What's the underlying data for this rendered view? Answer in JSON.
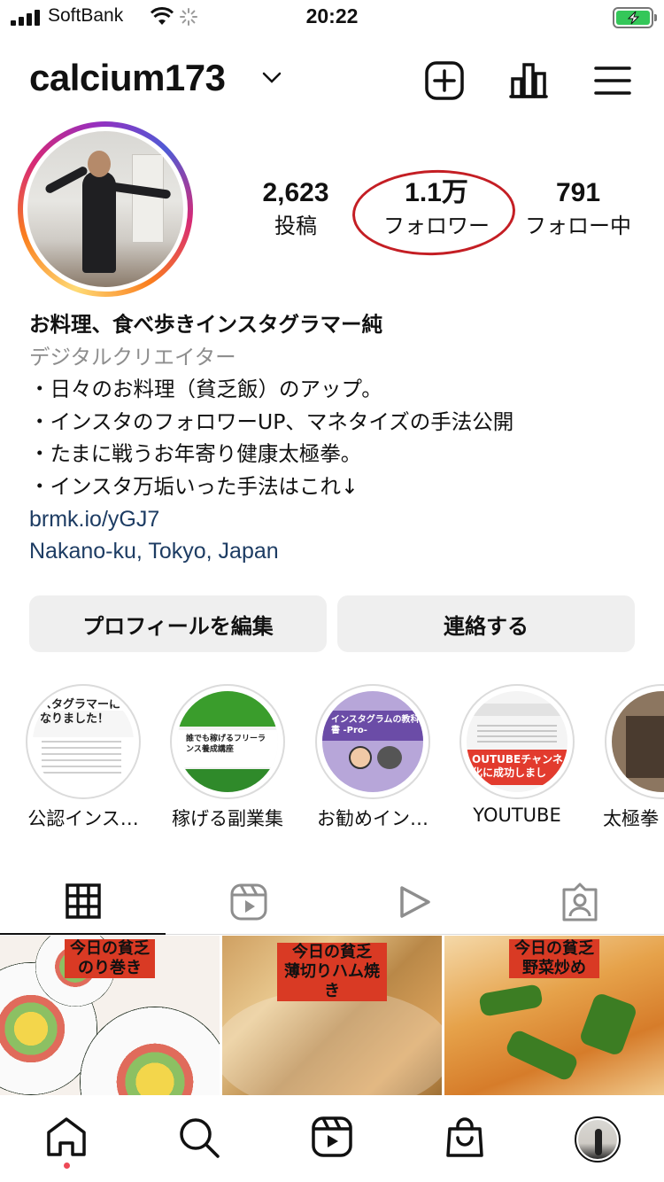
{
  "status_bar": {
    "carrier": "SoftBank",
    "time": "20:22"
  },
  "header": {
    "username": "calcium173",
    "icons": [
      "chevron-down-icon",
      "new-post-icon",
      "insights-icon",
      "menu-icon"
    ]
  },
  "stats": {
    "posts": {
      "value": "2,623",
      "label": "投稿"
    },
    "followers": {
      "value": "1.1万",
      "label": "フォロワー"
    },
    "following": {
      "value": "791",
      "label": "フォロー中"
    }
  },
  "annotation": {
    "color": "#c41e24"
  },
  "bio": {
    "name": "お料理、食べ歩きインスタグラマー純",
    "category": "デジタルクリエイター",
    "lines": [
      "・日々のお料理（貧乏飯）のアップ。",
      "・インスタのフォロワーUP、マネタイズの手法公開",
      "・たまに戦うお年寄り健康太極拳。",
      "・インスタ万垢いった手法はこれ↓"
    ],
    "link": "brmk.io/yGJ7",
    "location": "Nakano-ku, Tokyo, Japan"
  },
  "buttons": {
    "edit_profile": "プロフィールを編集",
    "contact": "連絡する"
  },
  "highlights": [
    {
      "label": "公認インス…",
      "thumb_text": "スタグラマーになりました！"
    },
    {
      "label": "稼げる副業集",
      "thumb_text": "誰でも稼げるフリーランス養成講座"
    },
    {
      "label": "お勧めイン…",
      "thumb_text": "インスタグラムの教科書 -Pro-"
    },
    {
      "label": "YOUTUBE",
      "thumb_text": "OUTUBEチャンネ 化に成功しまし"
    },
    {
      "label": "太極拳"
    }
  ],
  "tabs": [
    "grid-icon",
    "reels-icon",
    "video-icon",
    "tagged-icon"
  ],
  "grid": [
    {
      "title": "今日の貧乏\nのり巻き"
    },
    {
      "title": "今日の貧乏\n薄切りハム焼き"
    },
    {
      "title": "今日の貧乏\n野菜炒め"
    }
  ],
  "bottom_nav": [
    "home-icon",
    "search-icon",
    "reels-icon",
    "shop-icon",
    "profile-avatar"
  ],
  "colors": {
    "link": "#1d3c63",
    "category": "#8e8e8e",
    "button_bg": "#efefef",
    "notification_dot": "#ed4956",
    "battery": "#34c759"
  }
}
